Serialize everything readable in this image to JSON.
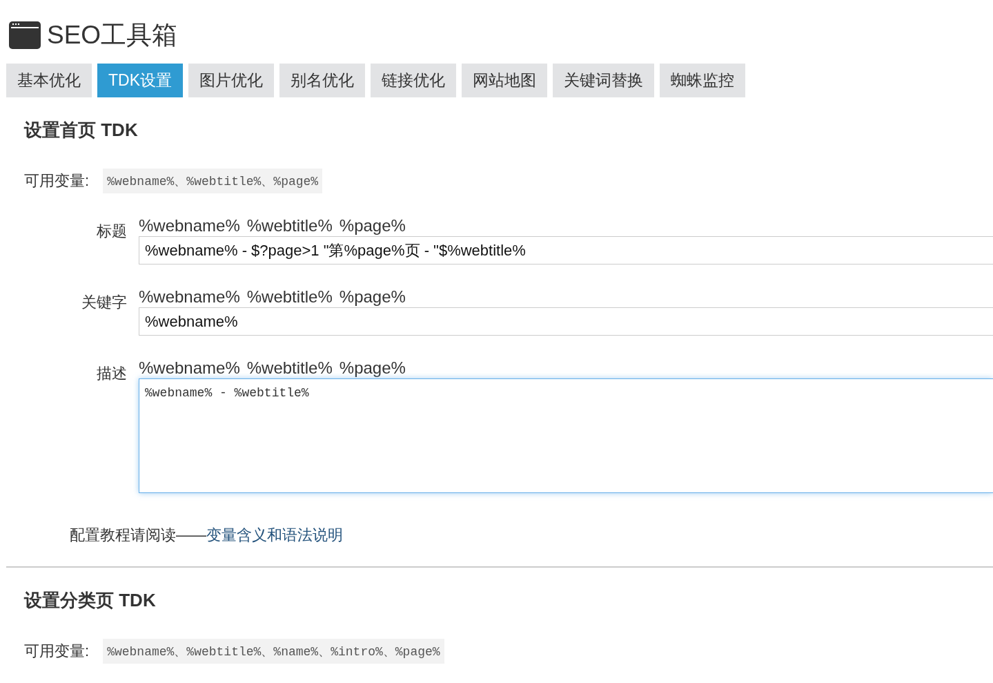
{
  "header": {
    "title": "SEO工具箱"
  },
  "tabs": [
    {
      "label": "基本优化",
      "selected": false
    },
    {
      "label": "TDK设置",
      "selected": true
    },
    {
      "label": "图片优化",
      "selected": false
    },
    {
      "label": "别名优化",
      "selected": false
    },
    {
      "label": "链接优化",
      "selected": false
    },
    {
      "label": "网站地图",
      "selected": false
    },
    {
      "label": "关键词替换",
      "selected": false
    },
    {
      "label": "蜘蛛监控",
      "selected": false
    }
  ],
  "home_section": {
    "heading": "设置首页 TDK",
    "variables_label": "可用变量:",
    "variables": "%webname%、%webtitle%、%page%",
    "fields": [
      {
        "kind": "input",
        "label": "标题",
        "hints": [
          "%webname%",
          "%webtitle%",
          "%page%"
        ],
        "value": "%webname% - $?page>1 \"第%page%页 - \"$%webtitle%",
        "focused": false
      },
      {
        "kind": "input",
        "label": "关键字",
        "hints": [
          "%webname%",
          "%webtitle%",
          "%page%"
        ],
        "value": "%webname%",
        "focused": false
      },
      {
        "kind": "textarea",
        "label": "描述",
        "hints": [
          "%webname%",
          "%webtitle%",
          "%page%"
        ],
        "value": "%webname% - %webtitle%",
        "focused": true
      }
    ],
    "help_text": "配置教程请阅读——",
    "help_link": "变量含义和语法说明"
  },
  "category_section": {
    "heading": "设置分类页 TDK",
    "variables_label": "可用变量:",
    "variables": "%webname%、%webtitle%、%name%、%intro%、%page%"
  }
}
